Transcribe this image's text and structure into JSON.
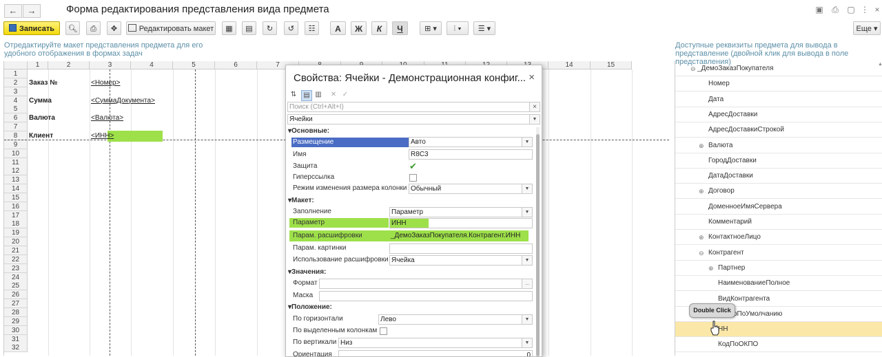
{
  "window": {
    "title": "Форма редактирования представления вида предмета",
    "back_icon": "←",
    "forward_icon": "→",
    "more_button": "Еще"
  },
  "toolbar": {
    "save_label": "Записать",
    "edit_layout_label": "Редактировать макет",
    "bold_label": "A",
    "italic_bold_label": "Ж",
    "italic_label": "К",
    "underline_label": "Ч"
  },
  "left_hint": "Отредактируйте макет представления предмета для его удобного отображения в формах задач",
  "right_hint": "Доступные реквизиты предмета для вывода в представление (двойной клик для вывода в поле представления)",
  "grid": {
    "columns": [
      "1",
      "2",
      "3",
      "4",
      "5",
      "6",
      "7",
      "8",
      "9",
      "10",
      "11",
      "12",
      "13",
      "14",
      "15"
    ],
    "rows": [
      "1",
      "2",
      "3",
      "4",
      "5",
      "6",
      "7",
      "8",
      "9",
      "10",
      "11",
      "12",
      "13",
      "14",
      "15",
      "16",
      "17",
      "18",
      "19",
      "20",
      "21",
      "22",
      "23",
      "24",
      "25",
      "26",
      "27",
      "28",
      "29",
      "30",
      "31",
      "32"
    ],
    "cells": {
      "r2c1": "Заказ №",
      "r2c3": "<Номер>",
      "r4c1": "Сумма",
      "r4c3": "<СуммаДокумента>",
      "r6c1": "Валюта",
      "r6c3": "<Валюта>",
      "r8c1": "Клиент",
      "r8c3": "<ИНН>"
    }
  },
  "dialog": {
    "title": "Свойства: Ячейки - Демонстрационная конфиг...",
    "close_icon": "×",
    "search_placeholder": "Поиск (Ctrl+Alt+I)",
    "object_select": "Ячейки",
    "sections": {
      "main": "Основные:",
      "layout": "Макет:",
      "values": "Значения:",
      "position": "Положение:"
    },
    "props": {
      "placement_label": "Размещение",
      "placement_value": "Авто",
      "name_label": "Имя",
      "name_value": "R8C3",
      "protection_label": "Защита",
      "hyperlink_label": "Гиперссылка",
      "resize_label": "Режим изменения размера колонки",
      "resize_value": "Обычный",
      "fill_label": "Заполнение",
      "fill_value": "Параметр",
      "param_label": "Параметр",
      "param_value": "ИНН",
      "decode_label": "Парам. расшифровки",
      "decode_value": "_ДемоЗаказПокупателя.Контрагент.ИНН",
      "picture_label": "Парам. картинки",
      "use_decode_label": "Использование расшифровки",
      "use_decode_value": "Ячейка",
      "format_label": "Формат",
      "mask_label": "Маска",
      "horiz_label": "По горизонтали",
      "horiz_value": "Лево",
      "by_cols_label": "По выделенным колонкам",
      "vert_label": "По вертикали",
      "vert_value": "Низ",
      "orient_label": "Ориентация",
      "orient_value": "0"
    }
  },
  "tree": {
    "items": [
      {
        "label": "_ДемоЗаказПокупателя",
        "indent": 0,
        "expander": "⊖"
      },
      {
        "label": "Номер",
        "indent": 1,
        "expander": ""
      },
      {
        "label": "Дата",
        "indent": 1,
        "expander": ""
      },
      {
        "label": "АдресДоставки",
        "indent": 1,
        "expander": ""
      },
      {
        "label": "АдресДоставкиСтрокой",
        "indent": 1,
        "expander": ""
      },
      {
        "label": "Валюта",
        "indent": 1,
        "expander": "⊕"
      },
      {
        "label": "ГородДоставки",
        "indent": 1,
        "expander": ""
      },
      {
        "label": "ДатаДоставки",
        "indent": 1,
        "expander": ""
      },
      {
        "label": "Договор",
        "indent": 1,
        "expander": "⊕"
      },
      {
        "label": "ДоменноеИмяСервера",
        "indent": 1,
        "expander": ""
      },
      {
        "label": "Комментарий",
        "indent": 1,
        "expander": ""
      },
      {
        "label": "КонтактноеЛицо",
        "indent": 1,
        "expander": "⊕"
      },
      {
        "label": "Контрагент",
        "indent": 1,
        "expander": "⊖"
      },
      {
        "label": "Партнер",
        "indent": 2,
        "expander": "⊕"
      },
      {
        "label": "НаименованиеПолное",
        "indent": 2,
        "expander": ""
      },
      {
        "label": "ВидКонтрагента",
        "indent": 2,
        "expander": ""
      },
      {
        "label": "рПоУмолчанию",
        "indent": 3,
        "expander": ""
      },
      {
        "label": "НН",
        "indent": 2,
        "expander": ""
      },
      {
        "label": "КодПоОКПО",
        "indent": 2,
        "expander": ""
      }
    ],
    "selected_index": 17
  },
  "tooltip": "Double Click"
}
